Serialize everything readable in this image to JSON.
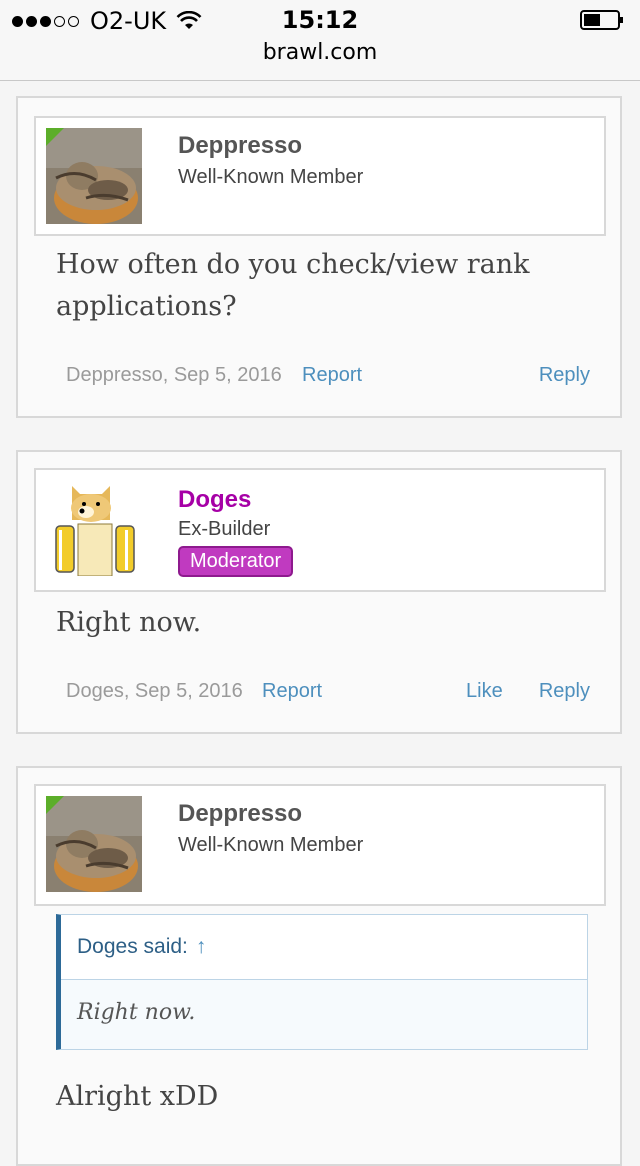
{
  "status_bar": {
    "carrier": "O2-UK",
    "time": "15:12",
    "signal_bars": 3,
    "signal_total": 5
  },
  "browser": {
    "url": "brawl.com"
  },
  "posts": [
    {
      "username": "Deppresso",
      "title": "Well-Known Member",
      "body_lines": [
        "How often do you check/view rank",
        "applications?"
      ],
      "meta": "Deppresso, Sep 5, 2016",
      "report": "Report",
      "reply": "Reply"
    },
    {
      "username": "Doges",
      "title": "Ex-Builder",
      "badge": "Moderator",
      "body_lines": [
        "Right now."
      ],
      "meta": "Doges, Sep 5, 2016",
      "report": "Report",
      "like": "Like",
      "reply": "Reply"
    },
    {
      "username": "Deppresso",
      "title": "Well-Known Member",
      "quote": {
        "author": "Doges said:",
        "arrow": "↑",
        "text": "Right now."
      },
      "body_lines": [
        "Alright xDD"
      ]
    }
  ],
  "colors": {
    "link": "#4d8fbd",
    "moderator": "#a600a6",
    "badge": "#c03ac0",
    "quote_border": "#2d6a98"
  }
}
